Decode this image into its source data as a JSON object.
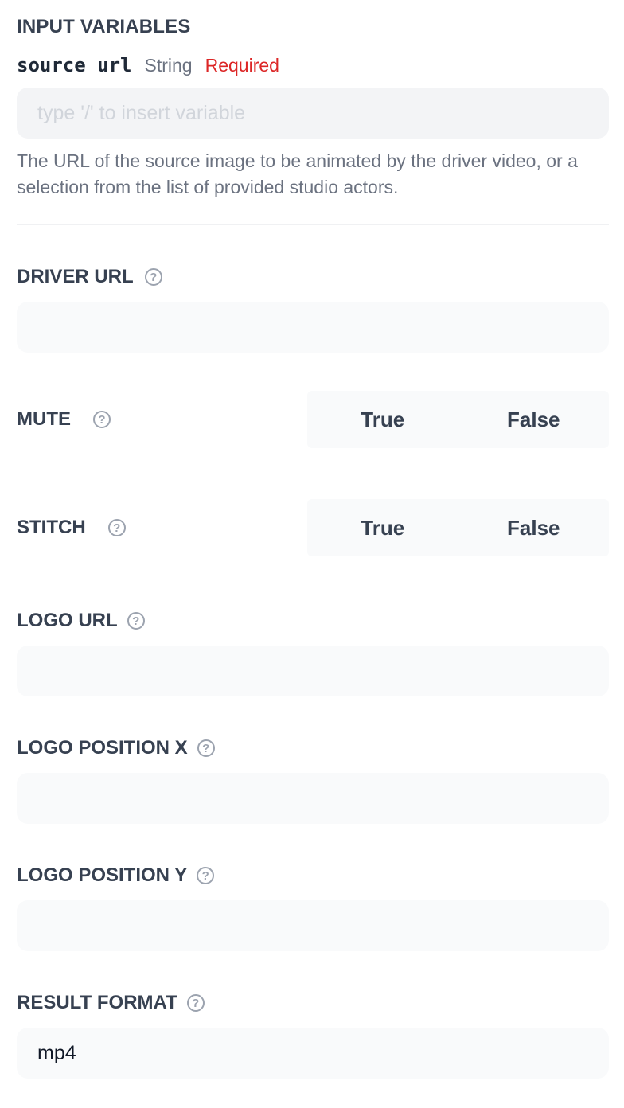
{
  "section_title": "INPUT VARIABLES",
  "source": {
    "name": "source url",
    "type": "String",
    "required": "Required",
    "placeholder": "type '/' to insert variable",
    "description": "The URL of the source image to be animated by the driver video, or a selection from the list of provided studio actors."
  },
  "fields": {
    "driver_url": {
      "label": "DRIVER URL",
      "value": ""
    },
    "mute": {
      "label": "MUTE",
      "options": [
        "True",
        "False"
      ]
    },
    "stitch": {
      "label": "STITCH",
      "options": [
        "True",
        "False"
      ]
    },
    "logo_url": {
      "label": "LOGO URL",
      "value": ""
    },
    "logo_position_x": {
      "label": "LOGO POSITION X",
      "value": ""
    },
    "logo_position_y": {
      "label": "LOGO POSITION Y",
      "value": ""
    },
    "result_format": {
      "label": "RESULT FORMAT",
      "value": "mp4"
    }
  },
  "help_glyph": "?",
  "colors": {
    "required": "#dc2626",
    "input_bg": "#f9fafb",
    "label": "#374151",
    "muted": "#6b7280"
  }
}
